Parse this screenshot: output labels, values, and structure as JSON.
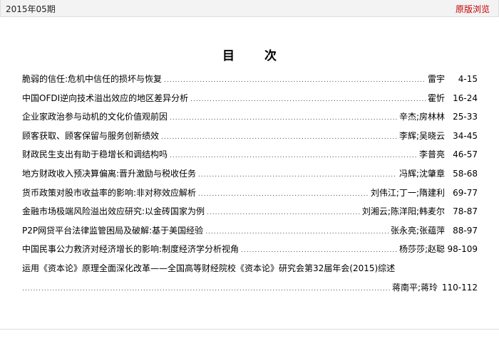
{
  "header": {
    "issue": "2015年05期",
    "original_link": "原版浏览"
  },
  "toc": {
    "title": "目 次",
    "entries": [
      {
        "title": "脆弱的信任:危机中信任的损坏与恢复",
        "authors": "雷宇",
        "pages": "4-15"
      },
      {
        "title": "中国OFDI逆向技术溢出效应的地区差异分析",
        "authors": "霍忻",
        "pages": "16-24"
      },
      {
        "title": "企业家政治参与动机的文化价值观前因",
        "authors": "辛杰;房林林",
        "pages": "25-33"
      },
      {
        "title": "顾客获取、顾客保留与服务创新绩效",
        "authors": "李辉;吴晓云",
        "pages": "34-45"
      },
      {
        "title": "财政民生支出有助于稳增长和调结构吗",
        "authors": "李普亮",
        "pages": "46-57"
      },
      {
        "title": "地方财政收入预决算偏离:晋升激励与税收任务",
        "authors": "冯辉;沈肇章",
        "pages": "58-68"
      },
      {
        "title": "货币政策对股市收益率的影响:非对称效应解析",
        "authors": "刘伟江;丁一;隋建利",
        "pages": "69-77"
      },
      {
        "title": "金融市场极端风险溢出效应研究:以金砖国家为例",
        "authors": "刘湘云;陈洋阳;韩麦尔",
        "pages": "78-87"
      },
      {
        "title": "P2P网贷平台法律监管困局及破解:基于美国经验",
        "authors": "张永亮;张蕴萍",
        "pages": "88-97"
      },
      {
        "title": "中国民事公力救济对经济增长的影响:制度经济学分析视角",
        "authors": "杨莎莎;赵聪",
        "pages": "98-109"
      },
      {
        "title": "运用《资本论》原理全面深化改革——全国高等财经院校《资本论》研究会第32届年会(2015)综述",
        "authors": "蒋南平;蒋玲",
        "pages": "110-112"
      }
    ]
  }
}
